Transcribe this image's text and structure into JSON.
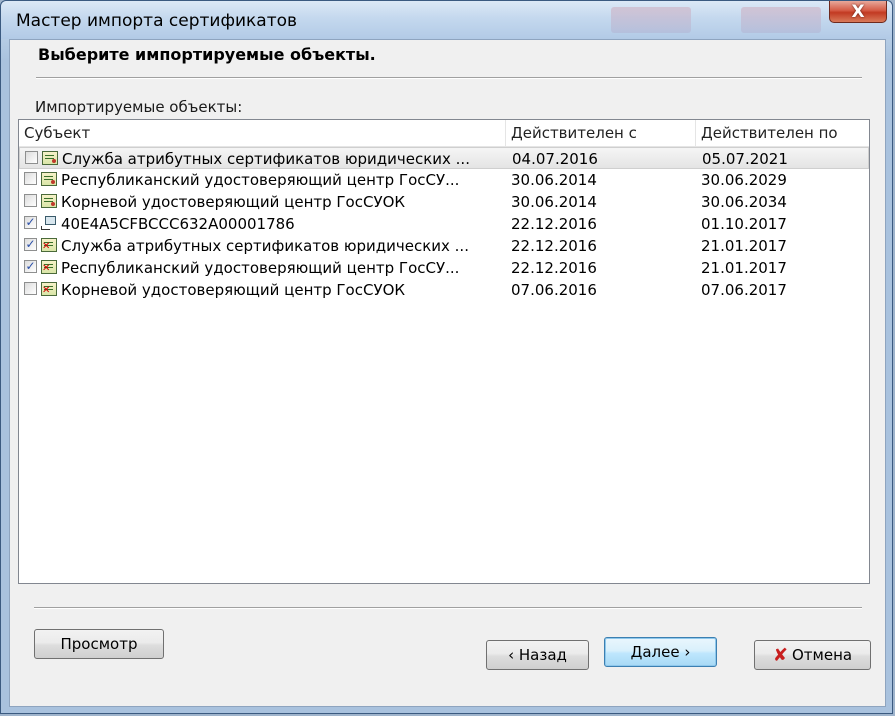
{
  "window": {
    "title": "Мастер импорта сертификатов",
    "close_glyph": "X"
  },
  "header": {
    "title": "Выберите импортируемые объекты."
  },
  "list": {
    "label": "Импортируемые объекты:",
    "columns": [
      "Субъект",
      "Действителен с",
      "Действителен по"
    ],
    "rows": [
      {
        "checked": false,
        "icon": "certificate-icon",
        "subject": "Служба атрибутных сертификатов юридических ...",
        "from": "04.07.2016",
        "to": "05.07.2021",
        "selected": true
      },
      {
        "checked": false,
        "icon": "certificate-icon",
        "subject": "Республиканский удостоверяющий центр ГосСУ...",
        "from": "30.06.2014",
        "to": "30.06.2029",
        "selected": false
      },
      {
        "checked": false,
        "icon": "certificate-icon",
        "subject": "Корневой удостоверяющий центр ГосСУОК",
        "from": "30.06.2014",
        "to": "30.06.2034",
        "selected": false
      },
      {
        "checked": true,
        "icon": "key-container-icon",
        "subject": "40E4A5CFBCCC632A00001786",
        "from": "22.12.2016",
        "to": "01.10.2017",
        "selected": false
      },
      {
        "checked": true,
        "icon": "invalid-certificate-icon",
        "subject": "Служба атрибутных сертификатов юридических ...",
        "from": "22.12.2016",
        "to": "21.01.2017",
        "selected": false
      },
      {
        "checked": true,
        "icon": "invalid-certificate-icon",
        "subject": "Республиканский удостоверяющий центр ГосСУ...",
        "from": "22.12.2016",
        "to": "21.01.2017",
        "selected": false
      },
      {
        "checked": false,
        "icon": "invalid-certificate-icon",
        "subject": "Корневой удостоверяющий центр ГосСУОК",
        "from": "07.06.2016",
        "to": "07.06.2017",
        "selected": false
      }
    ]
  },
  "buttons": {
    "view": "Просмотр",
    "back": "‹ Назад",
    "next": "Далее ›",
    "cancel": "Отмена",
    "cancel_icon": "✘"
  }
}
